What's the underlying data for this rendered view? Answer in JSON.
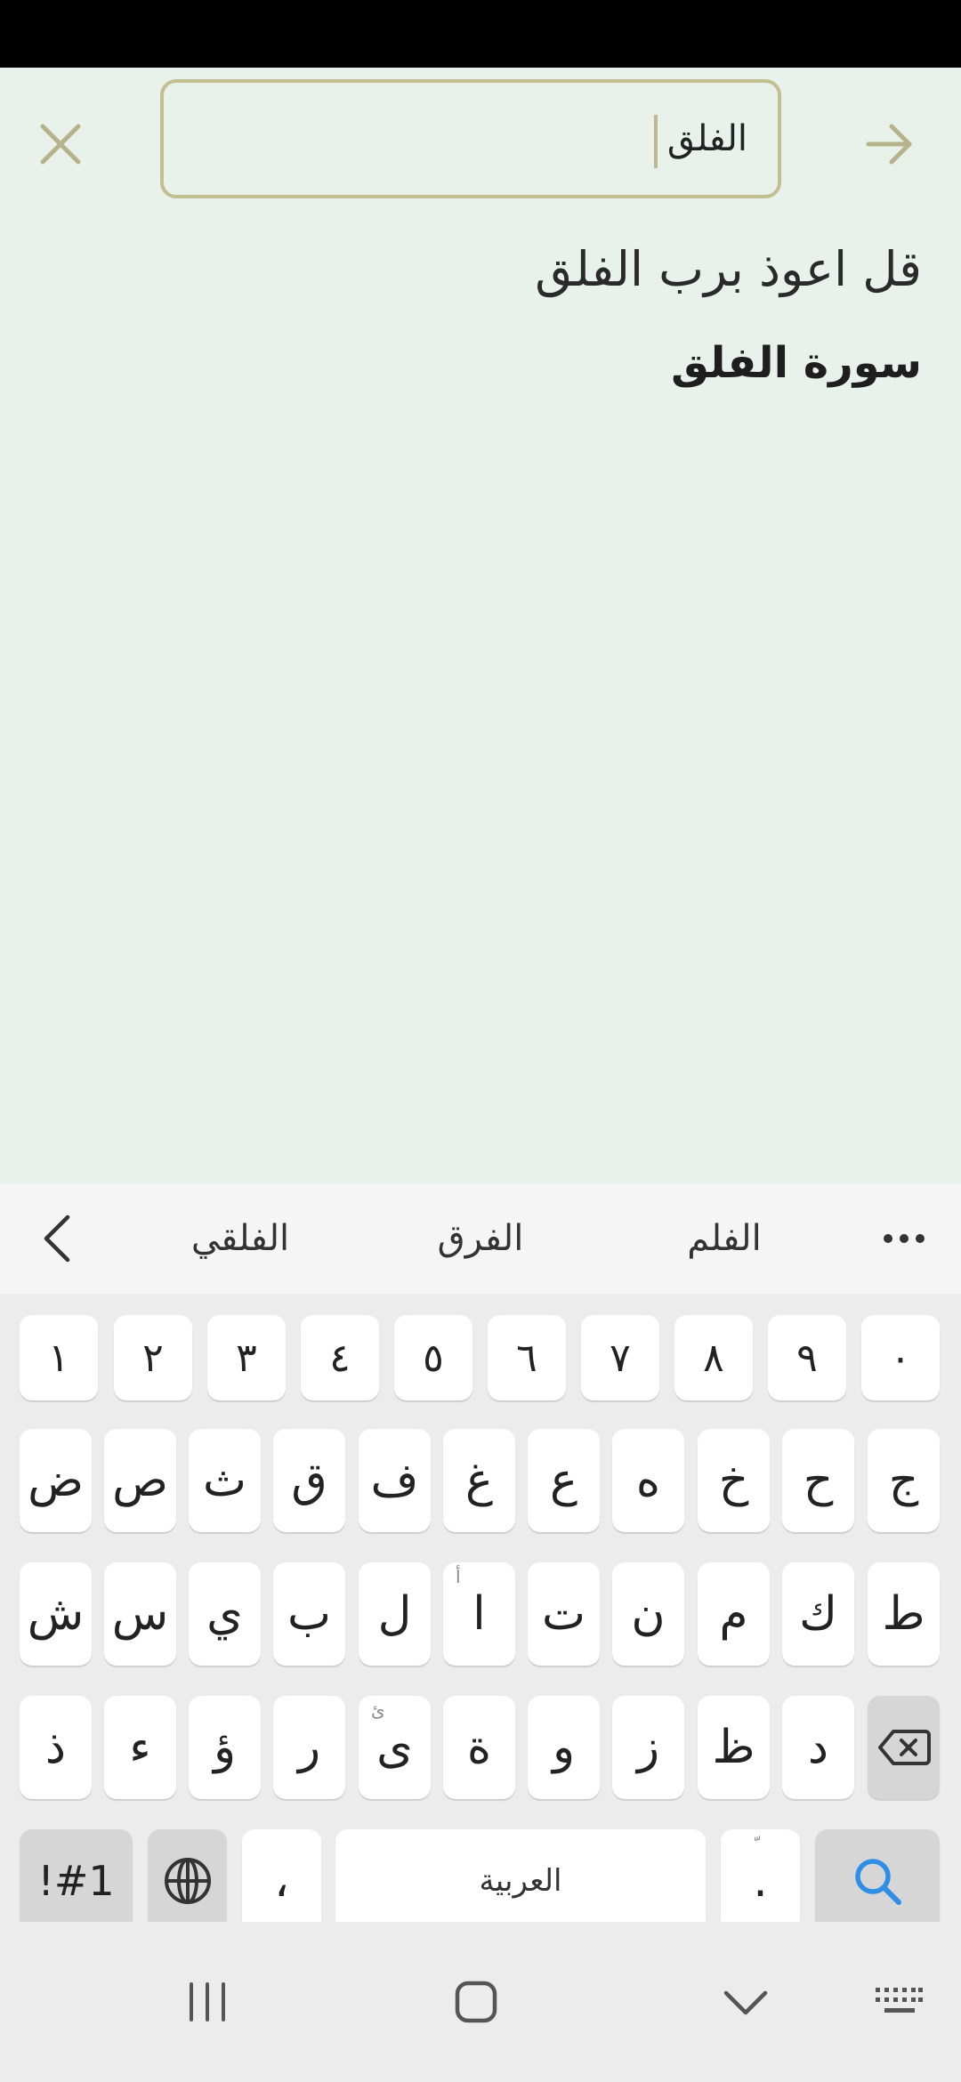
{
  "search": {
    "value": "الفلق",
    "placeholder": ""
  },
  "results": [
    {
      "text": "قل اعوذ برب الفلق"
    },
    {
      "text": "سورة الفلق"
    }
  ],
  "suggestions": {
    "items": [
      "الفلقي",
      "الفرق",
      "الفلم"
    ]
  },
  "keyboard": {
    "number_row": [
      "١",
      "٢",
      "٣",
      "٤",
      "٥",
      "٦",
      "٧",
      "٨",
      "٩",
      "٠"
    ],
    "row1": [
      "ض",
      "ص",
      "ث",
      "ق",
      "ف",
      "غ",
      "ع",
      "ه",
      "خ",
      "ح",
      "ج"
    ],
    "row2": [
      "ش",
      "س",
      "ي",
      "ب",
      "ل",
      "ا",
      "ت",
      "ن",
      "م",
      "ك",
      "ط"
    ],
    "row2_alt_alef": "أ",
    "row3": [
      "ذ",
      "ء",
      "ؤ",
      "ر",
      "ى",
      "ة",
      "و",
      "ز",
      "ظ",
      "د"
    ],
    "row3_alt_yeh": "ئ",
    "symbols_label": "!#1",
    "comma": "،",
    "space_label": "العربية",
    "period": ".",
    "period_alt": "ّ"
  },
  "colors": {
    "app_background": "#e9f2ea",
    "accent": "#bdb991",
    "keyboard_background": "#ececec",
    "search_key_icon": "#2f8ee6"
  },
  "icons": {
    "close": "close-icon",
    "forward": "arrow-right-icon",
    "back": "chevron-left-icon",
    "more": "more-horizontal-icon",
    "globe": "globe-icon",
    "backspace": "backspace-icon",
    "search": "search-icon",
    "recents": "recents-icon",
    "home": "home-icon",
    "nav_back": "chevron-down-icon",
    "keyboard": "keyboard-icon"
  }
}
